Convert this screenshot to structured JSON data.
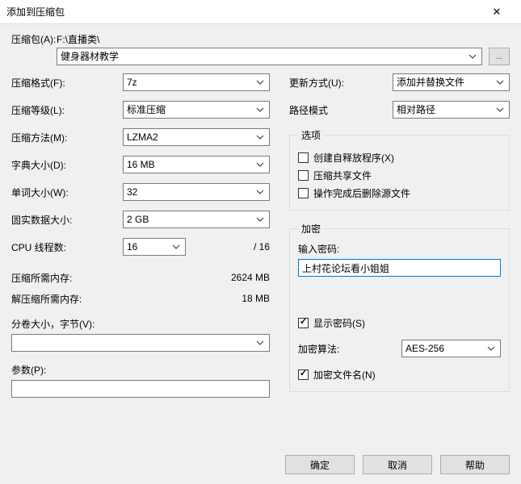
{
  "window": {
    "title": "添加到压缩包",
    "close_glyph": "✕"
  },
  "archive": {
    "label": "压缩包(A):",
    "path": "F:\\直播类\\",
    "name": "健身器材教学",
    "browse_glyph": "..."
  },
  "left": {
    "format": {
      "label": "压缩格式(F):",
      "value": "7z"
    },
    "level": {
      "label": "压缩等级(L):",
      "value": "标准压缩"
    },
    "method": {
      "label": "压缩方法(M):",
      "value": "LZMA2"
    },
    "dict": {
      "label": "字典大小(D):",
      "value": "16 MB"
    },
    "word": {
      "label": "单词大小(W):",
      "value": "32"
    },
    "solid": {
      "label": "固实数据大小:",
      "value": "2 GB"
    },
    "cpu": {
      "label": "CPU 线程数:",
      "value": "16",
      "total": "/ 16"
    },
    "mem_compress": {
      "label": "压缩所需内存:",
      "value": "2624 MB"
    },
    "mem_decompress": {
      "label": "解压缩所需内存:",
      "value": "18 MB"
    },
    "split": {
      "label": "分卷大小，字节(V):",
      "value": ""
    },
    "params": {
      "label": "参数(P):",
      "value": ""
    }
  },
  "right": {
    "update_mode": {
      "label": "更新方式(U):",
      "value": "添加并替换文件"
    },
    "path_mode": {
      "label": "路径模式",
      "value": "相对路径"
    },
    "options": {
      "legend": "选项",
      "sfx": {
        "label": "创建自释放程序(X)",
        "checked": false
      },
      "shared": {
        "label": "压缩共享文件",
        "checked": false
      },
      "delete": {
        "label": "操作完成后删除源文件",
        "checked": false
      }
    },
    "encryption": {
      "legend": "加密",
      "password_label": "输入密码:",
      "password_value": "上村花论坛看小姐姐",
      "show_password": {
        "label": "显示密码(S)",
        "checked": true
      },
      "algo": {
        "label": "加密算法:",
        "value": "AES-256"
      },
      "encrypt_names": {
        "label": "加密文件名(N)",
        "checked": true
      }
    }
  },
  "footer": {
    "ok": "确定",
    "cancel": "取消",
    "help": "帮助"
  }
}
